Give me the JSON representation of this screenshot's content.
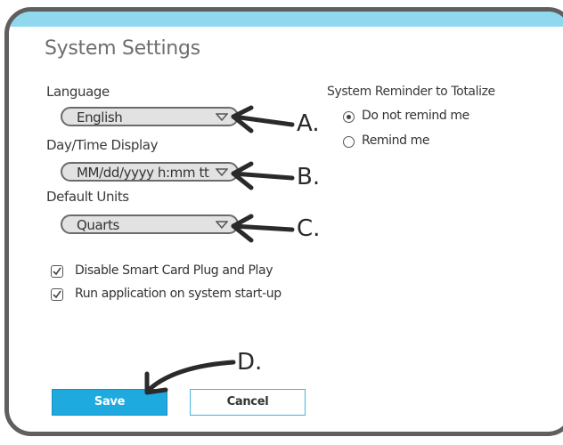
{
  "dialog": {
    "title": "System Settings"
  },
  "language": {
    "label": "Language",
    "value": "English"
  },
  "datetime": {
    "label": "Day/Time Display",
    "value": "MM/dd/yyyy h:mm tt"
  },
  "units": {
    "label": "Default Units",
    "value": "Quarts"
  },
  "options": {
    "disable_smart_card": {
      "label": "Disable Smart Card Plug and Play",
      "checked": true
    },
    "run_on_startup": {
      "label": "Run application on system start-up",
      "checked": true
    }
  },
  "reminder": {
    "label": "System Reminder to Totalize",
    "choices": [
      {
        "label": "Do not remind me",
        "selected": true
      },
      {
        "label": "Remind me",
        "selected": false
      }
    ]
  },
  "buttons": {
    "save": "Save",
    "cancel": "Cancel"
  },
  "annotations": {
    "a": "A.",
    "b": "B.",
    "c": "C.",
    "d": "D."
  }
}
